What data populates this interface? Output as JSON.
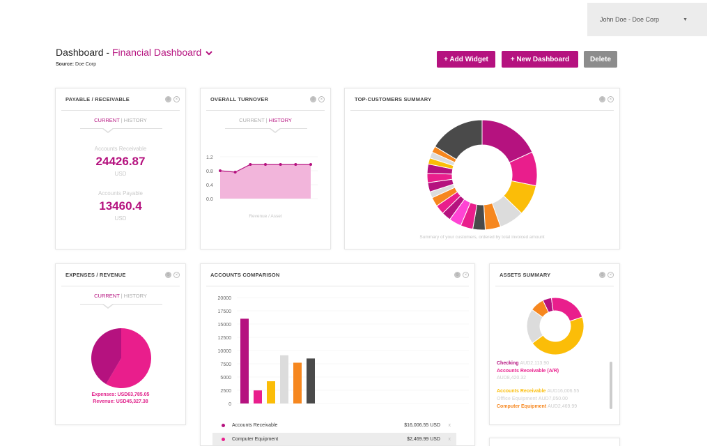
{
  "user_menu": {
    "label": "John Doe - Doe Corp",
    "caret": "▼"
  },
  "header": {
    "title_prefix": "Dashboard - ",
    "title_accent": "Financial Dashboard",
    "source_label": "Source:",
    "source_value": "Doe Corp"
  },
  "toolbar": {
    "add_widget": "+ Add Widget",
    "new_dashboard": "+ New Dashboard",
    "delete": "Delete"
  },
  "colors": {
    "accent": "#b5127f",
    "pink": "#e91e8c",
    "yellow": "#fbbd08",
    "orange": "#f6871f",
    "dark": "#4a4a4a",
    "light": "#dcdcdc"
  },
  "payable": {
    "title": "PAYABLE / RECEIVABLE",
    "tab_current": "CURRENT",
    "tab_sep": " | ",
    "tab_history": "HISTORY",
    "receivable_label": "Accounts Receivable",
    "receivable_value": "24426.87",
    "receivable_unit": "USD",
    "payable_label": "Accounts Payable",
    "payable_value": "13460.4",
    "payable_unit": "USD"
  },
  "turnover": {
    "title": "OVERALL TURNOVER",
    "tab_current": "CURRENT",
    "tab_sep": " | ",
    "tab_history": "HISTORY",
    "y_ticks": [
      "1.2",
      "0.8",
      "0.4",
      "0.0"
    ],
    "caption": "Revenue / Asset",
    "chart_data": {
      "type": "area",
      "values": [
        0.8,
        0.76,
        0.98,
        0.98,
        0.98,
        0.98,
        0.98
      ],
      "ylim": [
        0,
        1.2
      ]
    }
  },
  "top_customers": {
    "title": "TOP-CUSTOMERS SUMMARY",
    "caption": "Summary of your customers, ordered by total invoiced amount",
    "chart_data": {
      "type": "pie",
      "values": [
        20,
        11,
        10,
        8,
        5,
        4,
        4,
        4,
        3,
        3,
        3,
        2,
        3,
        3,
        3,
        2,
        2,
        2,
        18
      ],
      "colors": [
        "#b5127f",
        "#e91e8c",
        "#fbbd08",
        "#dcdcdc",
        "#f6871f",
        "#4a4a4a",
        "#e91e8c",
        "#ff44d4",
        "#b5127f",
        "#e91e8c",
        "#f6871f",
        "#dcdcdc",
        "#b5127f",
        "#e91e8c",
        "#b5127f",
        "#fbbd08",
        "#dcdcdc",
        "#f6871f",
        "#4a4a4a"
      ]
    }
  },
  "expenses": {
    "title": "EXPENSES / REVENUE",
    "tab_current": "CURRENT",
    "tab_sep": " | ",
    "tab_history": "HISTORY",
    "expenses_text": "Expenses: USD63,785.05",
    "revenue_text": "Revenue: USD45,327.38",
    "chart_data": {
      "type": "pie",
      "values": [
        63785.05,
        45327.38
      ],
      "colors": [
        "#e91e8c",
        "#b5127f"
      ]
    }
  },
  "comparison": {
    "title": "ACCOUNTS COMPARISON",
    "y_ticks": [
      "20000",
      "17500",
      "15000",
      "12500",
      "10000",
      "7500",
      "5000",
      "2500",
      "0"
    ],
    "chart_data": {
      "type": "bar",
      "values": [
        16006.55,
        2469.99,
        4200,
        9100,
        7700,
        8500
      ],
      "colors": [
        "#b5127f",
        "#e91e8c",
        "#fbbd08",
        "#dcdcdc",
        "#f6871f",
        "#4a4a4a"
      ],
      "ylim": [
        0,
        20000
      ]
    },
    "rows": [
      {
        "name": "Accounts Receivable",
        "value": "$16,006.55 USD",
        "color": "#b5127f"
      },
      {
        "name": "Computer Equipment",
        "value": "$2,469.99 USD",
        "color": "#e91e8c"
      }
    ],
    "remove": "x"
  },
  "assets": {
    "title": "ASSETS SUMMARY",
    "items": [
      {
        "label": "Checking",
        "amount": "AUD2,113.90",
        "color": "#b5127f"
      },
      {
        "label": "Accounts Receivable (A/R)",
        "amount": "AUD8,420.32",
        "color": "#e91e8c"
      },
      {
        "label": "Accounts Receivable",
        "amount": "AUD16,006.55",
        "color": "#fbbd08"
      },
      {
        "label": "Office Equipment",
        "amount": "AUD7,050.00",
        "color": "#dcdcdc"
      },
      {
        "label": "Computer Equipment",
        "amount": "AUD2,469.99",
        "color": "#f6871f"
      }
    ],
    "chart_data": {
      "type": "pie",
      "values": [
        5,
        22,
        45,
        20,
        8
      ],
      "colors": [
        "#b5127f",
        "#e91e8c",
        "#fbbd08",
        "#dcdcdc",
        "#f6871f"
      ]
    }
  },
  "tools": {
    "gear": "⚙",
    "close": "×"
  }
}
